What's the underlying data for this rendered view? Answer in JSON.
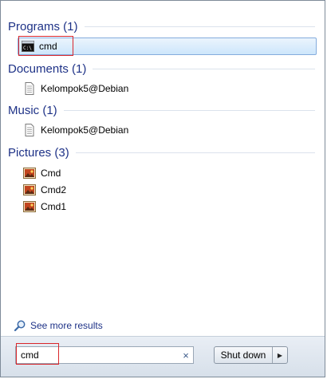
{
  "groups": [
    {
      "title": "Programs (1)",
      "items": [
        {
          "label": "cmd",
          "icon": "console-icon"
        }
      ]
    },
    {
      "title": "Documents (1)",
      "items": [
        {
          "label": "Kelompok5@Debian",
          "icon": "document-icon"
        }
      ]
    },
    {
      "title": "Music (1)",
      "items": [
        {
          "label": "Kelompok5@Debian",
          "icon": "document-icon"
        }
      ]
    },
    {
      "title": "Pictures (3)",
      "items": [
        {
          "label": "Cmd",
          "icon": "picture-icon"
        },
        {
          "label": "Cmd2",
          "icon": "picture-icon"
        },
        {
          "label": "Cmd1",
          "icon": "picture-icon"
        }
      ]
    }
  ],
  "see_more": {
    "label": "See more results",
    "icon": "magnifier-icon"
  },
  "search": {
    "value": "cmd",
    "clear_glyph": "×"
  },
  "shutdown": {
    "label": "Shut down",
    "arrow_glyph": "▶"
  },
  "colors": {
    "header": "#1e3287",
    "highlight": "#d9262b",
    "selected_border": "#84acdd"
  }
}
